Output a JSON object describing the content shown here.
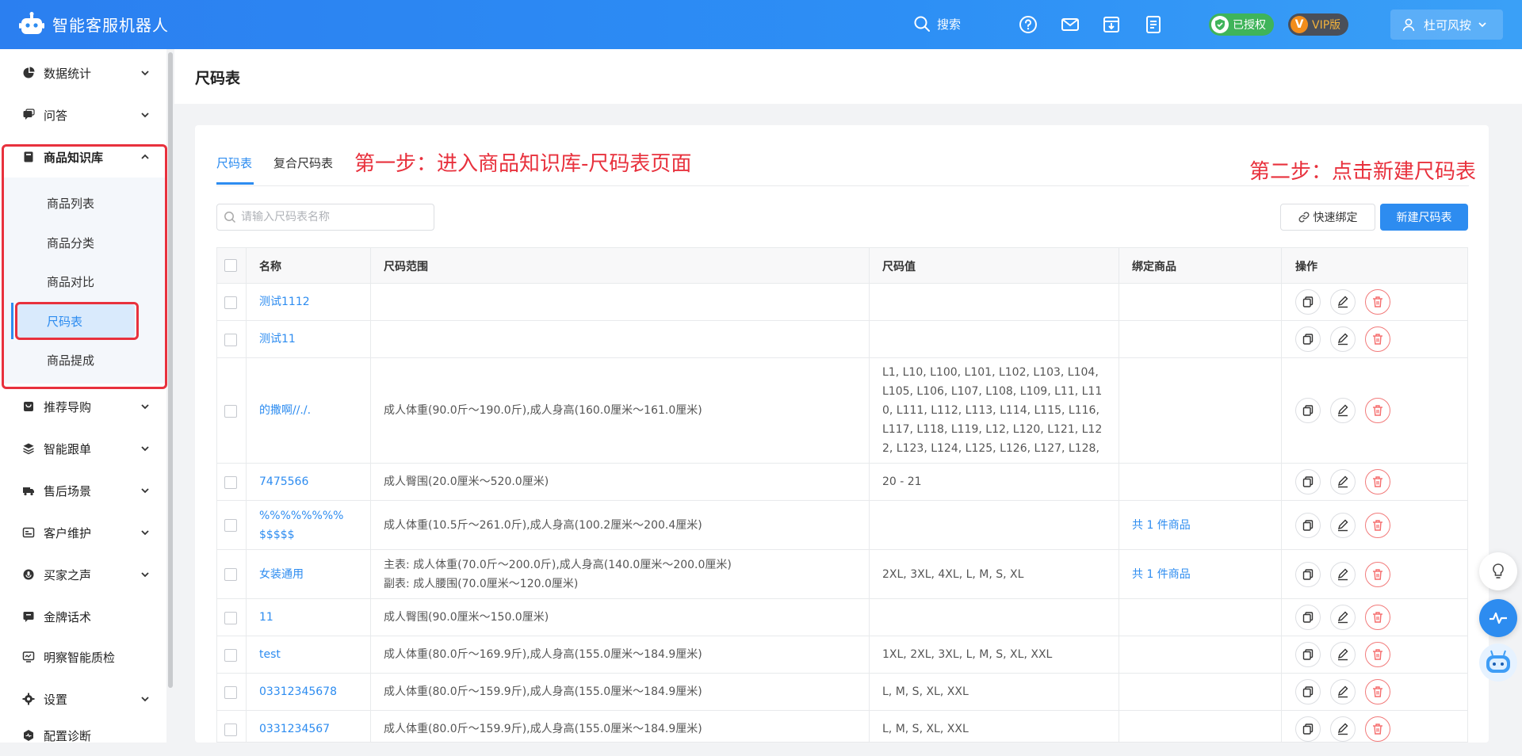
{
  "app": {
    "title": "智能客服机器人"
  },
  "topbar": {
    "search_label": "搜索",
    "authorized_label": "已授权",
    "vip_label": "VIP版",
    "vip_glyph": "V",
    "username": "杜可风按"
  },
  "sidebar": {
    "items": [
      {
        "label": "数据统计",
        "icon": "pie-chart-icon"
      },
      {
        "label": "问答",
        "icon": "chat-icon"
      },
      {
        "label": "商品知识库",
        "icon": "book-icon",
        "expanded": true
      },
      {
        "label": "推荐导购",
        "icon": "bag-icon"
      },
      {
        "label": "智能跟单",
        "icon": "layers-icon"
      },
      {
        "label": "售后场景",
        "icon": "truck-icon"
      },
      {
        "label": "客户维护",
        "icon": "id-card-icon"
      },
      {
        "label": "买家之声",
        "icon": "voice-icon"
      },
      {
        "label": "金牌话术",
        "icon": "medal-chat-icon"
      },
      {
        "label": "明察智能质检",
        "icon": "monitor-icon"
      },
      {
        "label": "设置",
        "icon": "gear-icon"
      },
      {
        "label": "配置诊断",
        "icon": "diagnose-icon"
      }
    ],
    "subitems": [
      "商品列表",
      "商品分类",
      "商品对比",
      "尺码表",
      "商品提成"
    ],
    "active_subitem": "尺码表"
  },
  "page": {
    "title": "尺码表",
    "tabs": [
      {
        "label": "尺码表",
        "active": true
      },
      {
        "label": "复合尺码表",
        "active": false
      }
    ],
    "search_placeholder": "请输入尺码表名称",
    "quick_bind_label": "快速绑定",
    "new_button_label": "新建尺码表"
  },
  "annotations": {
    "step1": "第一步：进入商品知识库-尺码表页面",
    "step2": "第二步：点击新建尺码表",
    "highlight_color": "#e8313d"
  },
  "table": {
    "columns": [
      "名称",
      "尺码范围",
      "尺码值",
      "绑定商品",
      "操作"
    ],
    "rows": [
      {
        "name": "测试1112",
        "range": "",
        "values": "",
        "bound": ""
      },
      {
        "name": "测试11",
        "range": "",
        "values": "",
        "bound": ""
      },
      {
        "name": "的撒啊//./.",
        "range": "成人体重(90.0斤～190.0斤),成人身高(160.0厘米～161.0厘米)",
        "values": "L1, L10, L100, L101, L102, L103, L104, L105, L106, L107, L108, L109, L11, L110, L111, L112, L113, L114, L115, L116, L117, L118, L119, L12, L120, L121, L122, L123, L124, L125, L126, L127, L128, ...",
        "bound": ""
      },
      {
        "name": "7475566",
        "range": "成人臀围(20.0厘米～520.0厘米)",
        "values": "20 - 21",
        "bound": ""
      },
      {
        "name": "%%%%%%%%$$$$$",
        "range": "成人体重(10.5斤～261.0斤),成人身高(100.2厘米～200.4厘米)",
        "values": "",
        "bound": "共 1 件商品"
      },
      {
        "name": "女装通用",
        "range": "主表: 成人体重(70.0斤～200.0斤),成人身高(140.0厘米～200.0厘米)\n副表: 成人腰围(70.0厘米～120.0厘米)",
        "values": "2XL, 3XL, 4XL, L, M, S, XL",
        "bound": "共 1 件商品"
      },
      {
        "name": "11",
        "range": "成人臀围(90.0厘米～150.0厘米)",
        "values": "",
        "bound": ""
      },
      {
        "name": "test",
        "range": "成人体重(80.0斤～169.9斤),成人身高(155.0厘米～184.9厘米)",
        "values": "1XL, 2XL, 3XL, L, M, S, XL, XXL",
        "bound": ""
      },
      {
        "name": "03312345678",
        "range": "成人体重(80.0斤～159.9斤),成人身高(155.0厘米～184.9厘米)",
        "values": "L, M, S, XL, XXL",
        "bound": ""
      },
      {
        "name": "0331234567",
        "range": "成人体重(80.0斤～159.9斤),成人身高(155.0厘米～184.9厘米)",
        "values": "L, M, S, XL, XXL",
        "bound": ""
      }
    ]
  },
  "colors": {
    "primary": "#2d8cf0",
    "danger": "#f56c6c",
    "annotation": "#e8313d"
  }
}
